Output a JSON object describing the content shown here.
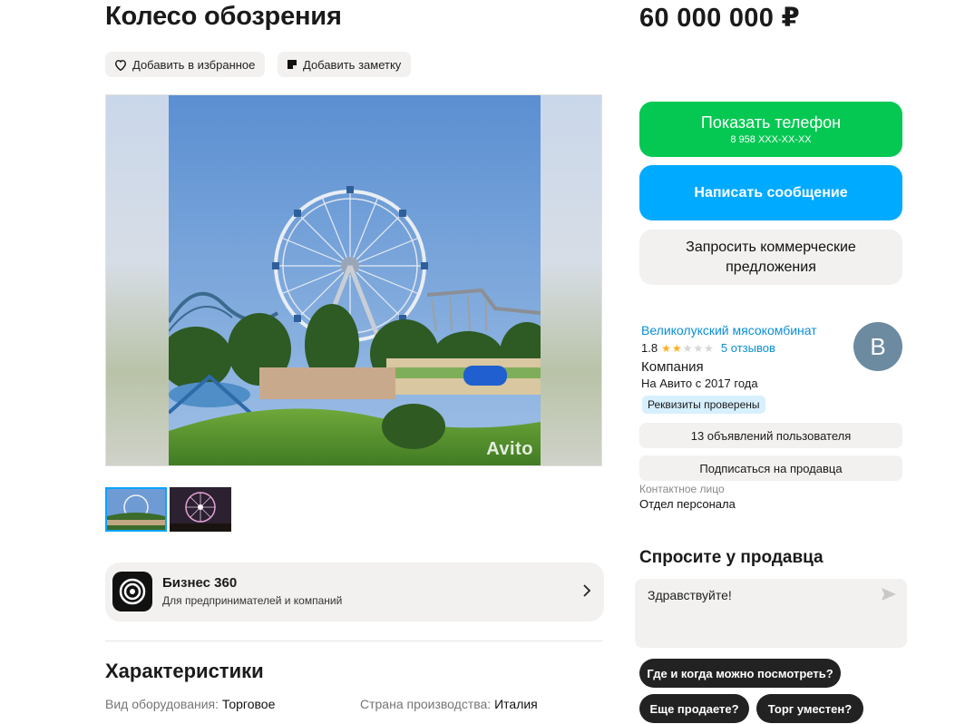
{
  "listing": {
    "title": "Колесо обозрения",
    "price": "60 000 000 ₽",
    "actions": {
      "favorite_label": "Добавить в избранное",
      "note_label": "Добавить заметку"
    },
    "gallery": {
      "watermark": "Avito",
      "thumbnail_count": 2
    }
  },
  "business_banner": {
    "title": "Бизнес 360",
    "subtitle": "Для предпринимателей и компаний"
  },
  "characteristics": {
    "heading": "Характеристики",
    "items": [
      {
        "key": "Вид оборудования:",
        "value": "Торговое"
      },
      {
        "key": "Страна производства:",
        "value": "Италия"
      }
    ]
  },
  "contact_buttons": {
    "phone_label": "Показать телефон",
    "phone_masked": "8 958 XXX-XX-XX",
    "message_label": "Написать сообщение",
    "commercial_label": "Запросить коммерческие предложения"
  },
  "seller": {
    "name": "Великолукский мясокомбинат",
    "rating": "1.8",
    "rating_value": 1.8,
    "rating_max": 5,
    "reviews": "5 отзывов",
    "type": "Компания",
    "since": "На Авито с 2017 года",
    "verified_badge": "Реквизиты проверены",
    "avatar_letter": "В",
    "listings_button": "13 объявлений пользователя",
    "subscribe_button": "Подписаться на продавца",
    "contact_person_label": "Контактное лицо",
    "contact_person_value": "Отдел персонала"
  },
  "ask_seller": {
    "heading": "Спросите у продавца",
    "message_value": "Здравствуйте!",
    "quick_replies": [
      "Где и когда можно посмотреть?",
      "Еще продаете?",
      "Торг уместен?"
    ]
  },
  "colors": {
    "green": "#04c852",
    "blue": "#00aaff",
    "link": "#0a8fd6",
    "star": "#ffb021",
    "chip_bg": "#f2f1ef"
  }
}
